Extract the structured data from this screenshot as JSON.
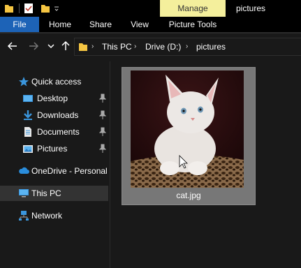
{
  "titlebar": {
    "context_tab": "Manage",
    "window_title": "pictures"
  },
  "ribbon": {
    "tabs": [
      {
        "label": "File",
        "active": true
      },
      {
        "label": "Home"
      },
      {
        "label": "Share"
      },
      {
        "label": "View"
      },
      {
        "label": "Picture Tools"
      }
    ]
  },
  "address": {
    "crumbs": [
      "This PC",
      "Drive (D:)",
      "pictures"
    ]
  },
  "nav": {
    "items": [
      {
        "label": "Quick access",
        "icon": "star-icon"
      },
      {
        "label": "Desktop",
        "icon": "desktop-icon",
        "pinned": true
      },
      {
        "label": "Downloads",
        "icon": "download-icon",
        "pinned": true
      },
      {
        "label": "Documents",
        "icon": "document-icon",
        "pinned": true
      },
      {
        "label": "Pictures",
        "icon": "pictures-icon",
        "pinned": true
      },
      {
        "label": "OneDrive - Personal",
        "icon": "cloud-icon"
      },
      {
        "label": "This PC",
        "icon": "computer-icon",
        "selected": true
      },
      {
        "label": "Network",
        "icon": "network-icon"
      }
    ]
  },
  "files": [
    {
      "name": "cat.jpg",
      "selected": true
    }
  ],
  "colors": {
    "file_tab": "#1d63b7",
    "manage_tab": "#f4ef9c",
    "background": "#191919"
  }
}
